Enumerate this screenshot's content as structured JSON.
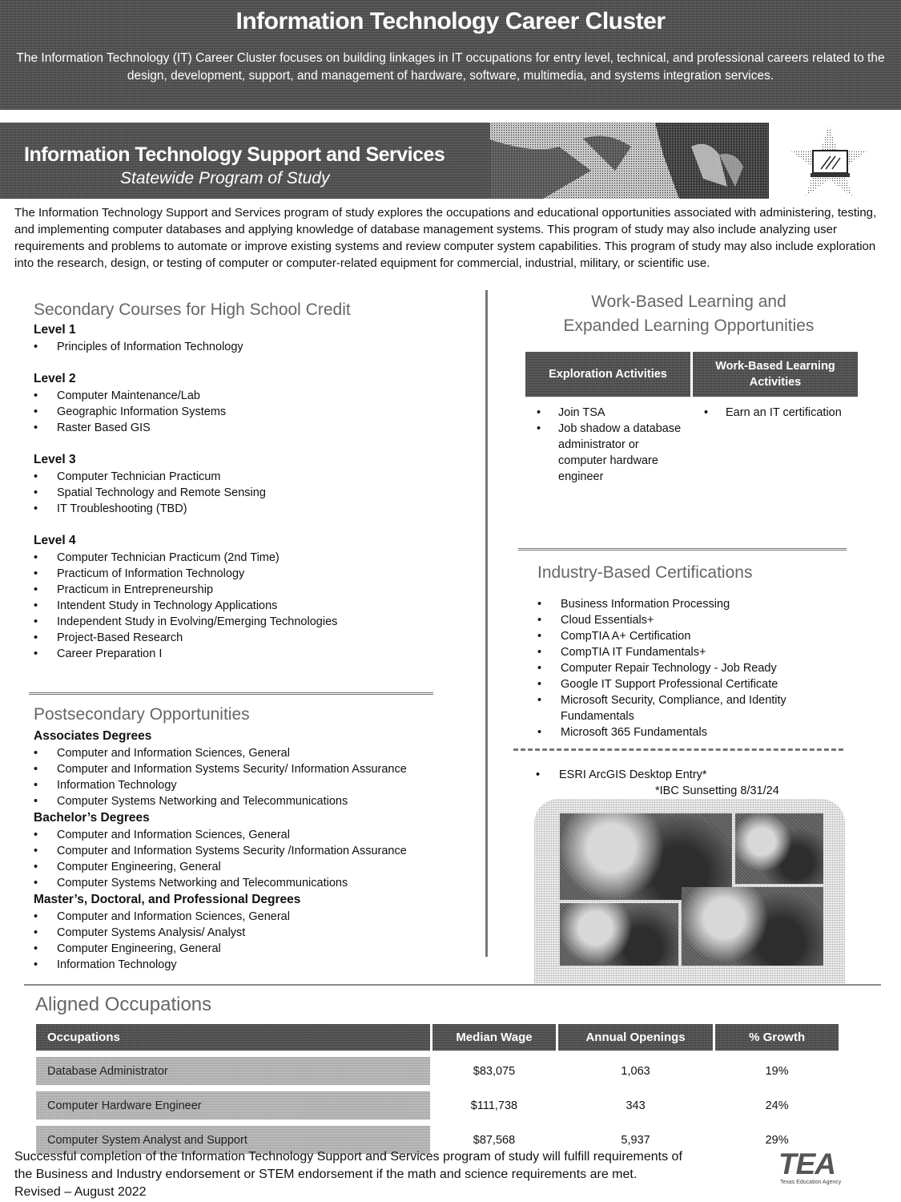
{
  "banner": {
    "title": "Information Technology Career Cluster",
    "description": "The Information Technology (IT) Career Cluster focuses on building linkages in IT occupations for entry level, technical, and professional careers related to the design, development, support, and management of hardware, software, multimedia, and systems integration services."
  },
  "program": {
    "title": "Information Technology Support and Services",
    "subtitle": "Statewide Program of Study",
    "description": "The Information Technology Support and Services program of study explores the occupations and educational opportunities associated with administering, testing, and implementing computer databases and applying knowledge of database management systems. This program of study may also include analyzing user requirements and problems to automate or improve existing systems and review computer system capabilities. This program of study may also include exploration into the research, design, or testing of computer or computer-related equipment for commercial, industrial, military, or scientific use.",
    "icon": "star-laptop-icon"
  },
  "secondary": {
    "heading": "Secondary Courses for High School Credit",
    "levels": [
      {
        "label": "Level 1",
        "courses": [
          "Principles of Information Technology"
        ]
      },
      {
        "label": "Level 2",
        "courses": [
          "Computer Maintenance/Lab",
          "Geographic Information Systems",
          "Raster Based GIS"
        ]
      },
      {
        "label": "Level 3",
        "courses": [
          "Computer Technician Practicum",
          "Spatial Technology and Remote Sensing",
          "IT Troubleshooting (TBD)"
        ]
      },
      {
        "label": "Level 4",
        "courses": [
          "Computer Technician Practicum (2nd Time)",
          "Practicum of Information Technology",
          "Practicum in Entrepreneurship",
          "Intendent Study in Technology Applications",
          "Independent Study in Evolving/Emerging Technologies",
          "Project-Based Research",
          "Career Preparation I"
        ]
      }
    ]
  },
  "postsecondary": {
    "heading": "Postsecondary Opportunities",
    "groups": [
      {
        "label": "Associates Degrees",
        "items": [
          "Computer and Information Sciences, General",
          "Computer and Information Systems Security/ Information Assurance",
          "Information Technology",
          "Computer Systems Networking and Telecommunications"
        ]
      },
      {
        "label": "Bachelor’s Degrees",
        "items": [
          "Computer and Information Sciences, General",
          "Computer and Information Systems Security /Information Assurance",
          "Computer Engineering, General",
          "Computer Systems Networking and Telecommunications"
        ]
      },
      {
        "label": "Master’s, Doctoral, and Professional Degrees",
        "items": [
          "Computer and Information Sciences, General",
          "Computer Systems Analysis/ Analyst",
          "Computer Engineering, General",
          "Information Technology"
        ]
      }
    ]
  },
  "wbl": {
    "heading_line1": "Work-Based Learning and",
    "heading_line2": "Expanded Learning Opportunities",
    "columns": [
      {
        "header": "Exploration Activities",
        "items": [
          "Join TSA",
          "Job shadow a database administrator or computer hardware engineer"
        ]
      },
      {
        "header": "Work-Based Learning Activities",
        "items": [
          "Earn an IT certification"
        ]
      }
    ]
  },
  "ibc": {
    "heading": "Industry-Based Certifications",
    "items": [
      "Business Information Processing",
      "Cloud Essentials+",
      "CompTIA A+ Certification",
      "CompTIA IT Fundamentals+",
      "Computer Repair Technology - Job Ready",
      "Google IT Support Professional Certificate",
      "Microsoft Security, Compliance, and Identity Fundamentals",
      "Microsoft 365 Fundamentals"
    ],
    "sunsetting_items": [
      "ESRI ArcGIS Desktop Entry*"
    ],
    "note": "*IBC Sunsetting 8/31/24"
  },
  "occupations": {
    "heading": "Aligned Occupations",
    "columns": [
      "Occupations",
      "Median Wage",
      "Annual Openings",
      "% Growth"
    ],
    "rows": [
      {
        "occupation": "Database Administrator",
        "wage": "$83,075",
        "openings": "1,063",
        "growth": "19%"
      },
      {
        "occupation": "Computer Hardware Engineer",
        "wage": "$111,738",
        "openings": "343",
        "growth": "24%"
      },
      {
        "occupation": "Computer System Analyst and Support",
        "wage": "$87,568",
        "openings": "5,937",
        "growth": "29%"
      }
    ]
  },
  "footer": {
    "line1": "Successful completion of the Information Technology Support and Services program of study will fulfill requirements of",
    "line2": "the Business and Industry endorsement or STEM endorsement if the math and science requirements are met.",
    "revised": "Revised – August 2022",
    "logo_text": "TEA",
    "logo_caption": "Texas Education Agency"
  }
}
